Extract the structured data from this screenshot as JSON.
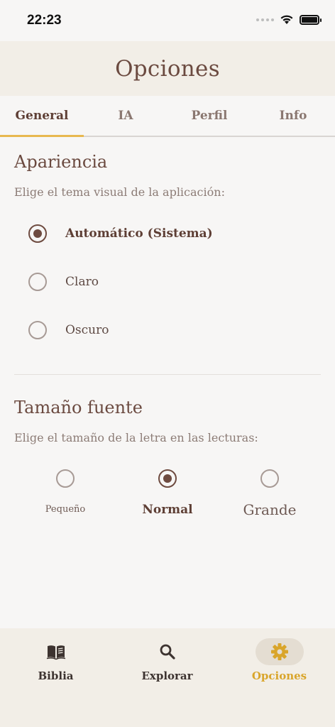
{
  "status_bar": {
    "time": "22:23"
  },
  "header": {
    "title": "Opciones"
  },
  "tabs": [
    {
      "label": "General",
      "active": true
    },
    {
      "label": "IA",
      "active": false
    },
    {
      "label": "Perfil",
      "active": false
    },
    {
      "label": "Info",
      "active": false
    }
  ],
  "appearance": {
    "title": "Apariencia",
    "subtitle": "Elige el tema visual de la aplicación:",
    "options": [
      {
        "label": "Automático (Sistema)",
        "selected": true
      },
      {
        "label": "Claro",
        "selected": false
      },
      {
        "label": "Oscuro",
        "selected": false
      }
    ]
  },
  "font_size": {
    "title": "Tamaño fuente",
    "subtitle": "Elige el tamaño de la letra en las lecturas:",
    "options": [
      {
        "label": "Pequeño",
        "selected": false
      },
      {
        "label": "Normal",
        "selected": true
      },
      {
        "label": "Grande",
        "selected": false
      }
    ]
  },
  "bottom_nav": {
    "items": [
      {
        "label": "Biblia",
        "icon": "book-icon",
        "active": false
      },
      {
        "label": "Explorar",
        "icon": "search-icon",
        "active": false
      },
      {
        "label": "Opciones",
        "icon": "gear-icon",
        "active": true
      }
    ]
  },
  "colors": {
    "accent": "#e8b84f",
    "active_nav": "#d9a52b",
    "primary": "#6e4b40"
  }
}
